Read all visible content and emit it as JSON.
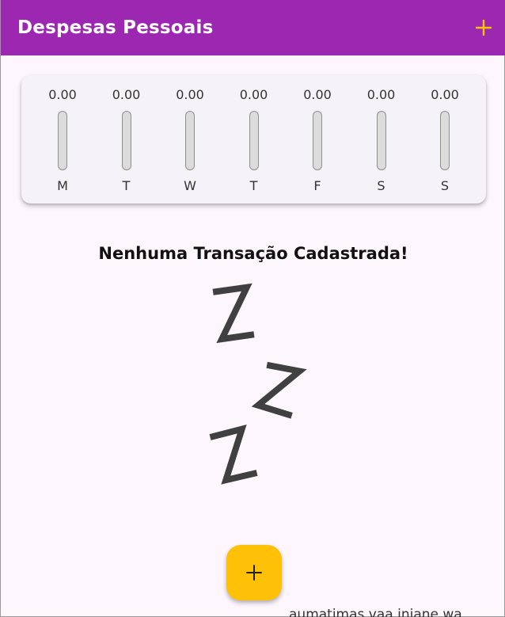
{
  "appbar": {
    "title": "Despesas Pessoais",
    "add_icon": "plus-icon",
    "accent_color": "#ffc107",
    "background_color": "#9c27b0"
  },
  "chart": {
    "days": [
      {
        "day": "M",
        "value": "0.00",
        "fraction": 0
      },
      {
        "day": "T",
        "value": "0.00",
        "fraction": 0
      },
      {
        "day": "W",
        "value": "0.00",
        "fraction": 0
      },
      {
        "day": "T",
        "value": "0.00",
        "fraction": 0
      },
      {
        "day": "F",
        "value": "0.00",
        "fraction": 0
      },
      {
        "day": "S",
        "value": "0.00",
        "fraction": 0
      },
      {
        "day": "S",
        "value": "0.00",
        "fraction": 0
      }
    ]
  },
  "empty_state": {
    "message": "Nenhuma Transação Cadastrada!",
    "image": "sleeping-zzz-icon"
  },
  "fab": {
    "icon": "plus-icon",
    "color": "#ffc107"
  },
  "footer_peek": "aumatimas vaa iniane wa"
}
